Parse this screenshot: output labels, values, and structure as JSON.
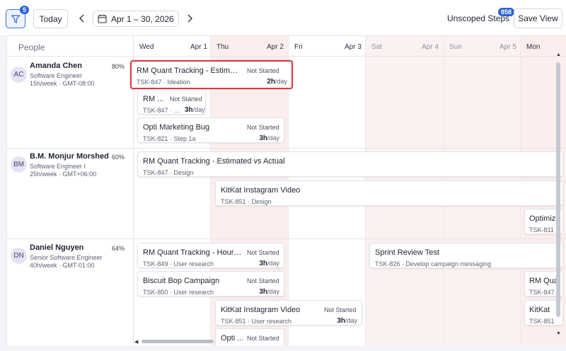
{
  "toolbar": {
    "filter_badge": "5",
    "today_label": "Today",
    "date_range": "Apr 1 – 30, 2026",
    "unscoped_label": "Unscoped Steps",
    "unscoped_count": "858",
    "save_view_label": "Save View"
  },
  "grid": {
    "people_header": "People",
    "days": [
      {
        "dow": "Wed",
        "date": "Apr 1"
      },
      {
        "dow": "Thu",
        "date": "Apr 2"
      },
      {
        "dow": "Fri",
        "date": "Apr 3"
      },
      {
        "dow": "Sat",
        "date": "Apr 4"
      },
      {
        "dow": "Sun",
        "date": "Apr 5"
      },
      {
        "dow": "Mon",
        "date": ""
      }
    ]
  },
  "people": [
    {
      "initials": "AC",
      "name": "Amanda Chen",
      "role": "Software Engineer",
      "meta": "15h/week · GMT-08:00",
      "utilization": "80%"
    },
    {
      "initials": "BM",
      "name": "B.M. Monjur Morshed",
      "role": "Software Engineer I",
      "meta": "25h/week · GMT+06:00",
      "utilization": "60%"
    },
    {
      "initials": "DN",
      "name": "Daniel Nguyen",
      "role": "Senior Software Engineer",
      "meta": "40h/week · GMT-01:00",
      "utilization": "64%"
    }
  ],
  "tasks": [
    {
      "title": "RM Quant Tracking - Estimat...",
      "status": "Not Started",
      "sub": "TSK-847 · Ideation",
      "hours": "2h",
      "unit": "/day"
    },
    {
      "title": "RM ...",
      "status": "Not Started",
      "sub": "TSK-847 · U...",
      "hours": "3h",
      "unit": "/day"
    },
    {
      "title": "Opti Marketing Bug",
      "status": "Not Started",
      "sub": "TSK-821 · Step 1a",
      "hours": "3h",
      "unit": "/day"
    },
    {
      "title": "RM Quant Tracking - Estimated vs Actual",
      "status": "",
      "sub": "TSK-847 · Design",
      "hours": "",
      "unit": ""
    },
    {
      "title": "KitKat Instagram Video",
      "status": "",
      "sub": "TSK-851 · Design",
      "hours": "",
      "unit": ""
    },
    {
      "title": "Optimize",
      "status": "",
      "sub": "TSK-811 ·",
      "hours": "",
      "unit": ""
    },
    {
      "title": "RM Quant Tracking - Hours ...",
      "status": "Not Started",
      "sub": "TSK-849 · User research",
      "hours": "3h",
      "unit": "/day"
    },
    {
      "title": "Sprint Review Test",
      "status": "",
      "sub": "TSK-826 · Develop campaign messaging",
      "hours": "",
      "unit": ""
    },
    {
      "title": "Biscuit Bop Campaign",
      "status": "Not Started",
      "sub": "TSK-850 · User research",
      "hours": "3h",
      "unit": "/day"
    },
    {
      "title": "RM Qua",
      "status": "",
      "sub": "TSK-847",
      "hours": "",
      "unit": ""
    },
    {
      "title": "KitKat Instagram Video",
      "status": "Not Started",
      "sub": "TSK-851 · User research",
      "hours": "3h",
      "unit": "/day"
    },
    {
      "title": "KitKat",
      "status": "",
      "sub": "TSK-851",
      "hours": "",
      "unit": ""
    },
    {
      "title": "Opti ...",
      "status": "Not Started",
      "sub": "",
      "hours": "",
      "unit": ""
    }
  ]
}
